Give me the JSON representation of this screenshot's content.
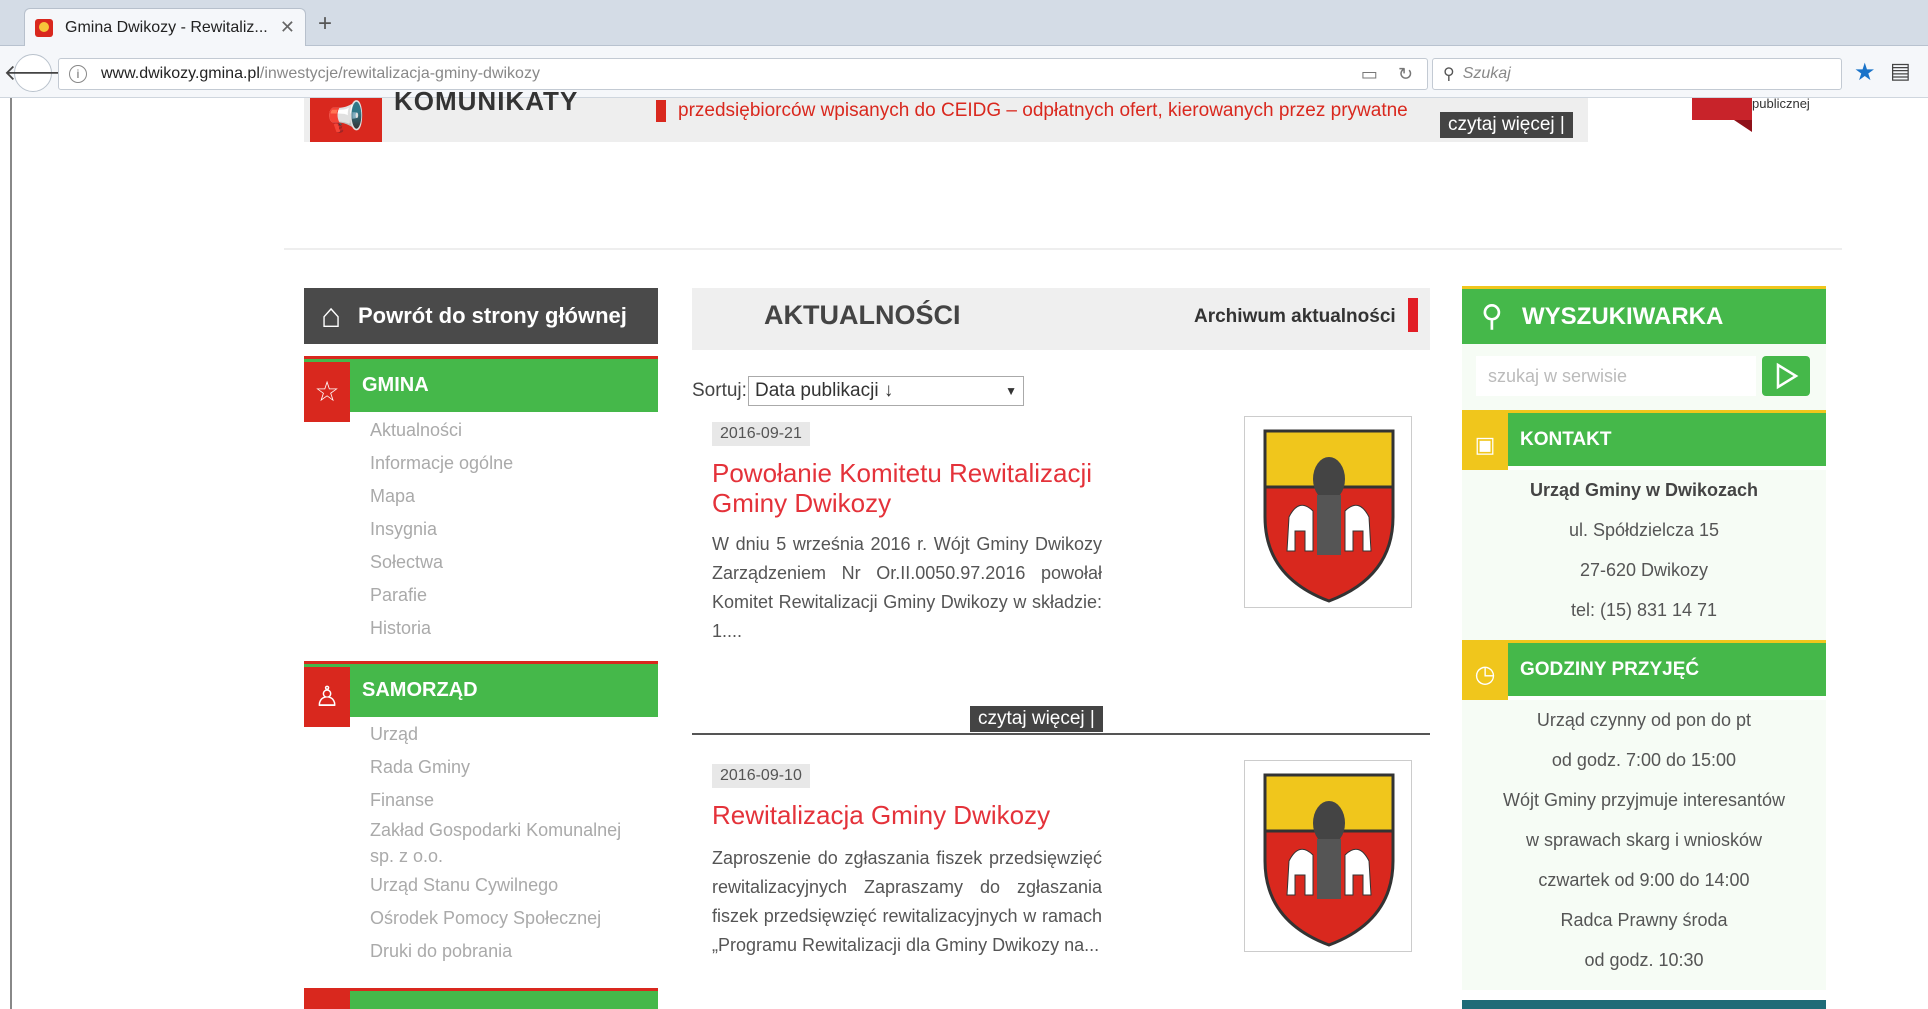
{
  "browser": {
    "tab_title": "Gmina Dwikozy - Rewitaliz...",
    "tab_close": "✕",
    "new_tab": "+",
    "url_host": "www.dwikozy.gmina.pl",
    "url_path": "/inwestycje/rewitalizacja-gminy-dwikozy",
    "search_placeholder": "Szukaj"
  },
  "banner": {
    "title": "KOMUNIKATY",
    "ticker": "przedsiębiorców wpisanych do CEIDG – odpłatnych ofert, kierowanych przez prywatne",
    "read_more": "czytaj więcej |",
    "flag_text": "publicznej"
  },
  "left": {
    "home": "Powrót do strony głównej",
    "gmina": {
      "title": "GMINA",
      "items": [
        "Aktualności",
        "Informacje ogólne",
        "Mapa",
        "Insygnia",
        "Sołectwa",
        "Parafie",
        "Historia"
      ]
    },
    "samorzad": {
      "title": "SAMORZĄD",
      "items": [
        "Urząd",
        "Rada Gminy",
        "Finanse",
        "Zakład Gospodarki Komunalnej",
        "sp. z o.o.",
        "Urząd Stanu Cywilnego",
        "Ośrodek Pomocy Społecznej",
        "Druki do pobrania"
      ]
    }
  },
  "news": {
    "title": "AKTUALNOŚCI",
    "archive": "Archiwum aktualności",
    "sort_label": "Sortuj:",
    "sort_value": "Data publikacji ↓",
    "articles": [
      {
        "date": "2016-09-21",
        "title": "Powołanie Komitetu Rewitalizacji Gminy Dwikozy",
        "text": "W dniu 5 września 2016 r. Wójt Gminy Dwikozy Zarządzeniem Nr Or.II.0050.97.2016 powołał Komitet Rewitalizacji Gminy Dwikozy w składzie: 1....",
        "read_more": "czytaj więcej |"
      },
      {
        "date": "2016-09-10",
        "title": "Rewitalizacja Gminy Dwikozy",
        "text": "Zaproszenie do zgłaszania fiszek przedsięwzięć rewitalizacyjnych Zapraszamy do zgłaszania fiszek przedsięwzięć rewitalizacyjnych w ramach „Programu Rewitalizacji dla Gminy Dwikozy na..."
      }
    ]
  },
  "right": {
    "search_title": "WYSZUKIWARKA",
    "search_placeholder": "szukaj w serwisie",
    "contact_title": "KONTAKT",
    "contact": [
      "Urząd Gminy w Dwikozach",
      "ul. Spółdzielcza 15",
      "27-620 Dwikozy",
      "tel: (15) 831 14 71"
    ],
    "hours_title": "GODZINY PRZYJĘĆ",
    "hours": [
      "Urząd czynny od pon do pt",
      "od godz. 7:00 do 15:00",
      "Wójt Gminy przyjmuje interesantów",
      "w sprawach skarg i wniosków",
      "czwartek od 9:00 do 14:00",
      "Radca Prawny środa",
      "od godz. 10:30"
    ]
  },
  "colors": {
    "green": "#45b84a",
    "red": "#d9281e",
    "yellow": "#f0c61c"
  }
}
